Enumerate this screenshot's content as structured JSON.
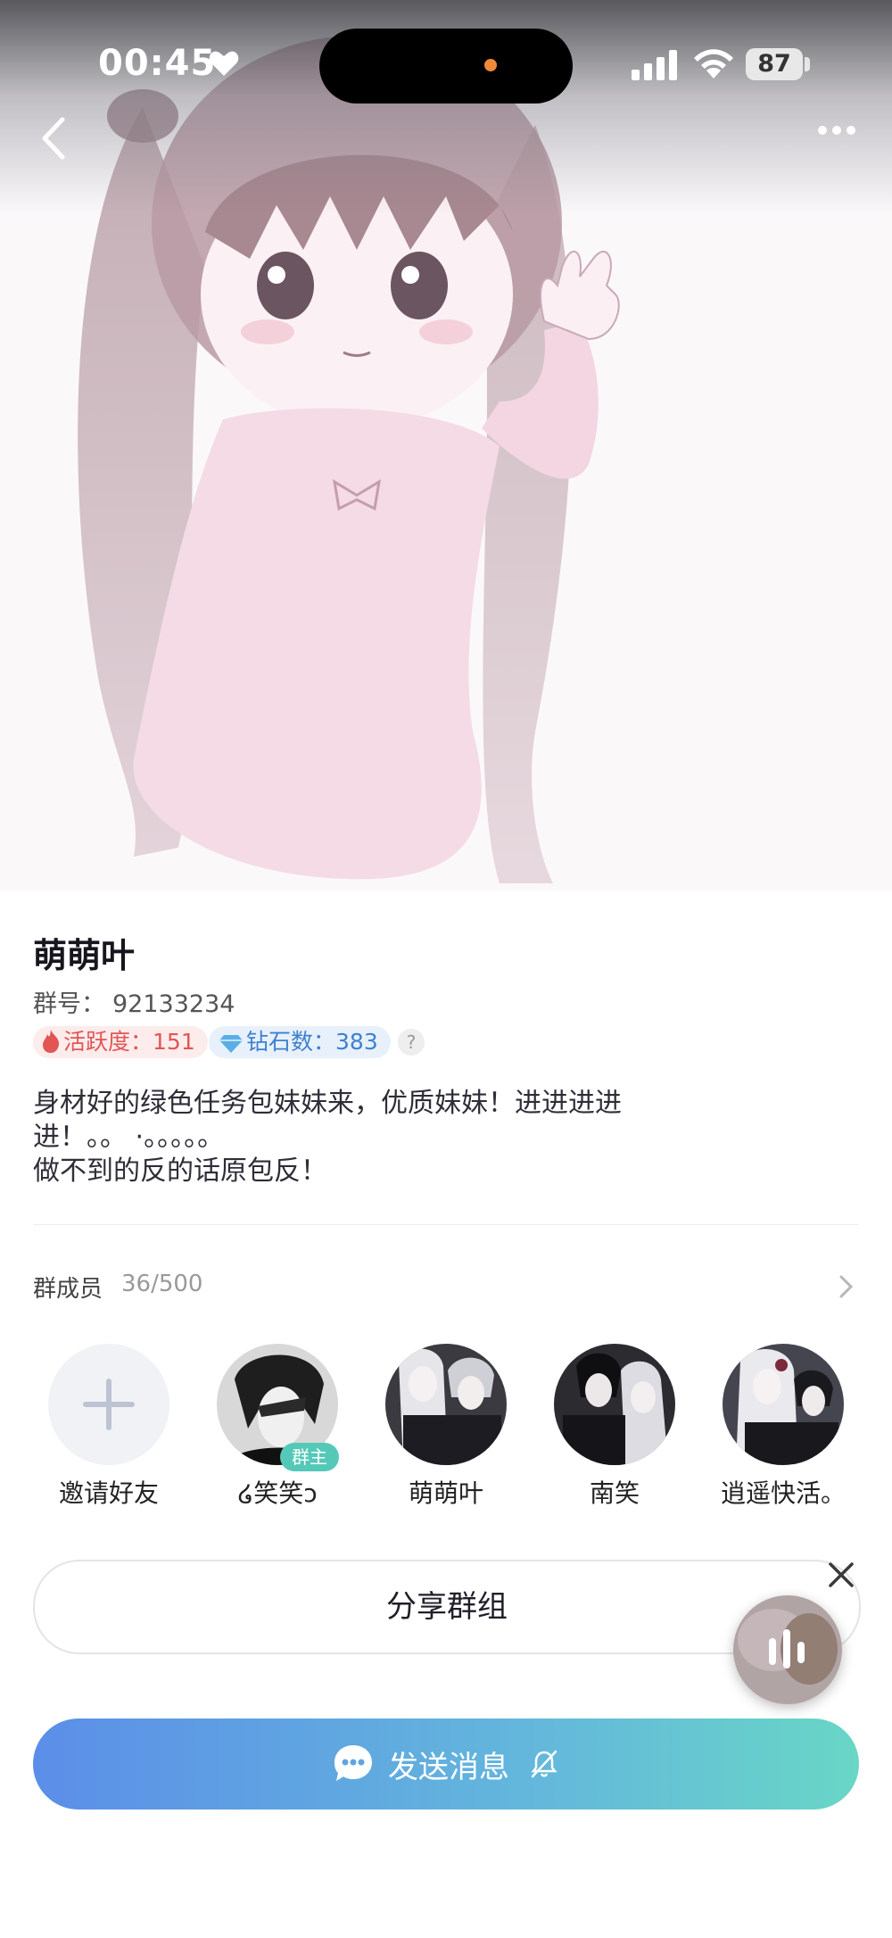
{
  "status_bar": {
    "time": "00:45",
    "battery": "87"
  },
  "hero": {
    "image_description": "anime-style girl with twin-tails in pink dress, waving",
    "icons": [
      "back-icon",
      "more-icon"
    ]
  },
  "group": {
    "name": "萌萌叶",
    "id_label": "群号：",
    "id_value": "92133234",
    "activity_label": "活跃度：",
    "activity_value": "151",
    "diamond_label": "钻石数：",
    "diamond_value": "383",
    "help": "?",
    "description": "身材好的绿色任务包妹妹来，优质妹妹！进进进进\n进！。。 ·。。。。。\n做不到的反的话原包反！"
  },
  "members": {
    "label": "群成员",
    "count": "36/500",
    "invite_label": "邀请好友",
    "owner_badge": "群主",
    "list": [
      {
        "name": "໒笑笑ↄ"
      },
      {
        "name": "萌萌叶"
      },
      {
        "name": "南笑"
      },
      {
        "name": "逍遥快活。"
      }
    ]
  },
  "actions": {
    "share_label": "分享群组",
    "send_label": "发送消息"
  },
  "colors": {
    "activity": "#e25555",
    "diamond": "#3e80d0",
    "owner_badge": "#55c9b8",
    "send_gradient_start": "#5b8ee8",
    "send_gradient_end": "#69d6c6"
  }
}
